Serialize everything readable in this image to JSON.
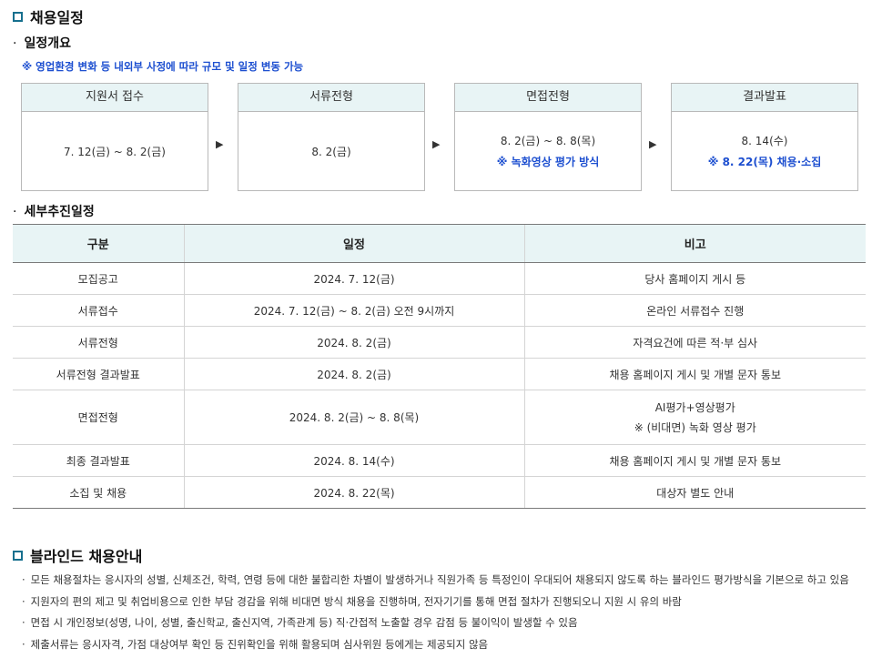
{
  "section1": {
    "title": "채용일정"
  },
  "overview": {
    "title": "일정개요",
    "notice": "※ 영업환경 변화 등 내외부 사정에 따라 규모 및 일정 변동 가능",
    "steps": [
      {
        "label": "지원서 접수",
        "date": "7. 12(금) ~ 8. 2(금)",
        "note": ""
      },
      {
        "label": "서류전형",
        "date": "8. 2(금)",
        "note": ""
      },
      {
        "label": "면접전형",
        "date": "8. 2(금) ~ 8. 8(목)",
        "note": "※ 녹화영상 평가 방식"
      },
      {
        "label": "결과발표",
        "date": "8. 14(수)",
        "note": "※ 8. 22(목) 채용·소집"
      }
    ],
    "arrow": "▶"
  },
  "detail": {
    "title": "세부추진일정",
    "headers": [
      "구분",
      "일정",
      "비고"
    ],
    "rows": [
      [
        "모집공고",
        "2024. 7. 12(금)",
        "당사 홈페이지 게시 등"
      ],
      [
        "서류접수",
        "2024. 7. 12(금) ~ 8. 2(금) 오전 9시까지",
        "온라인 서류접수 진행"
      ],
      [
        "서류전형",
        "2024. 8. 2(금)",
        "자격요건에 따른 적·부 심사"
      ],
      [
        "서류전형 결과발표",
        "2024. 8. 2(금)",
        "채용 홈페이지 게시 및 개별 문자 통보"
      ],
      [
        "면접전형",
        "2024. 8. 2(금) ~ 8. 8(목)",
        "AI평가+영상평가",
        "※ (비대면) 녹화 영상 평가"
      ],
      [
        "최종 결과발표",
        "2024. 8. 14(수)",
        "채용 홈페이지 게시 및 개별 문자 통보"
      ],
      [
        "소집 및 채용",
        "2024. 8. 22(목)",
        "대상자 별도 안내"
      ]
    ]
  },
  "section2": {
    "title": "블라인드 채용안내",
    "bullet": "·",
    "items": [
      "모든 채용절차는 응시자의 성별, 신체조건, 학력, 연령 등에 대한 불합리한 차별이 발생하거나 직원가족 등 특정인이 우대되어 채용되지 않도록 하는 블라인드 평가방식을 기본으로 하고 있음",
      "지원자의 편의 제고 및 취업비용으로 인한 부담 경감을 위해 비대면 방식 채용을 진행하며, 전자기기를 통해 면접 절차가 진행되오니 지원 시 유의 바람",
      "면접 시 개인정보(성명, 나이, 성별, 출신학교, 출신지역, 가족관계 등) 직·간접적 노출할 경우 감점 등 불이익이 발생할 수 있음",
      "제출서류는 응시자격, 가점 대상여부 확인 등 진위확인을 위해 활용되며 심사위원 등에게는 제공되지 않음"
    ]
  }
}
